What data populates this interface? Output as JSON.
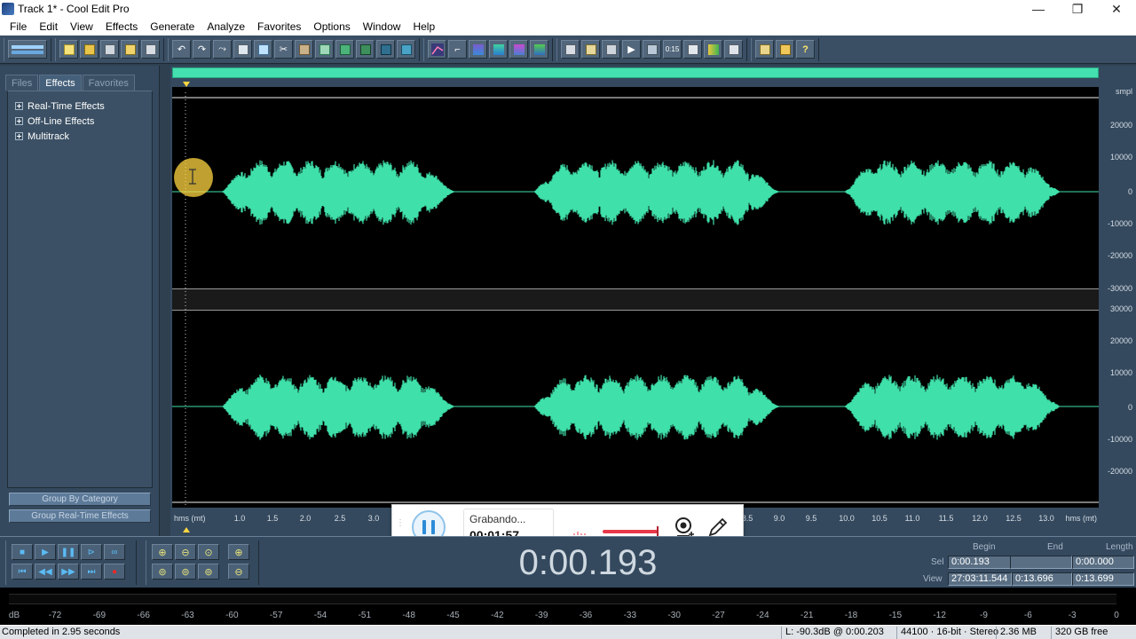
{
  "window": {
    "title": "Track 1* - Cool Edit Pro",
    "minimize": "—",
    "maximize": "❐",
    "close": "✕"
  },
  "menu": [
    "File",
    "Edit",
    "View",
    "Effects",
    "Generate",
    "Analyze",
    "Favorites",
    "Options",
    "Window",
    "Help"
  ],
  "left_panel": {
    "tabs": [
      "Files",
      "Effects",
      "Favorites"
    ],
    "active_tab": "Effects",
    "tree": [
      "Real-Time Effects",
      "Off-Line Effects",
      "Multitrack"
    ],
    "group_by_category": "Group By Category",
    "group_realtime": "Group Real-Time Effects"
  },
  "waveform": {
    "sample_unit": "smpl",
    "time_unit": "hms (mt)",
    "amplitude_labels_top": [
      "20000",
      "10000",
      "0",
      "-10000",
      "-20000",
      "-30000"
    ],
    "amplitude_labels_bottom": [
      "30000",
      "20000",
      "10000",
      "0",
      "-10000",
      "-20000"
    ],
    "time_labels": [
      "1.0",
      "1.5",
      "2.0",
      "2.5",
      "3.0",
      "8.5",
      "9.0",
      "9.5",
      "10.0",
      "10.5",
      "11.0",
      "11.5",
      "12.0",
      "12.5",
      "13.0"
    ],
    "wave_color": "#3fe0aa"
  },
  "recorder": {
    "status": "Grabando...",
    "time": "00:01:57",
    "icons": [
      "pause-icon",
      "webcam-icon",
      "pen-icon"
    ]
  },
  "transport": {
    "time": "0:00.193"
  },
  "selection": {
    "headers": [
      "Begin",
      "End",
      "Length"
    ],
    "sel_label": "Sel",
    "view_label": "View",
    "sel": [
      "0:00.193",
      "",
      "0:00.000"
    ],
    "view": [
      "27:03:11.544",
      "0:13.696",
      "0:13.699"
    ]
  },
  "meter": {
    "labels": [
      "dB",
      "-72",
      "-69",
      "-66",
      "-63",
      "-60",
      "-57",
      "-54",
      "-51",
      "-48",
      "-45",
      "-42",
      "-39",
      "-36",
      "-33",
      "-30",
      "-27",
      "-24",
      "-21",
      "-18",
      "-15",
      "-12",
      "-9",
      "-6",
      "-3",
      "0"
    ]
  },
  "status": {
    "message": "Completed in 2.95 seconds",
    "level": "L: -90.3dB @  0:00.203",
    "format": "44100 · 16-bit · Stereo",
    "size": "2.36 MB",
    "free": "320 GB free"
  }
}
